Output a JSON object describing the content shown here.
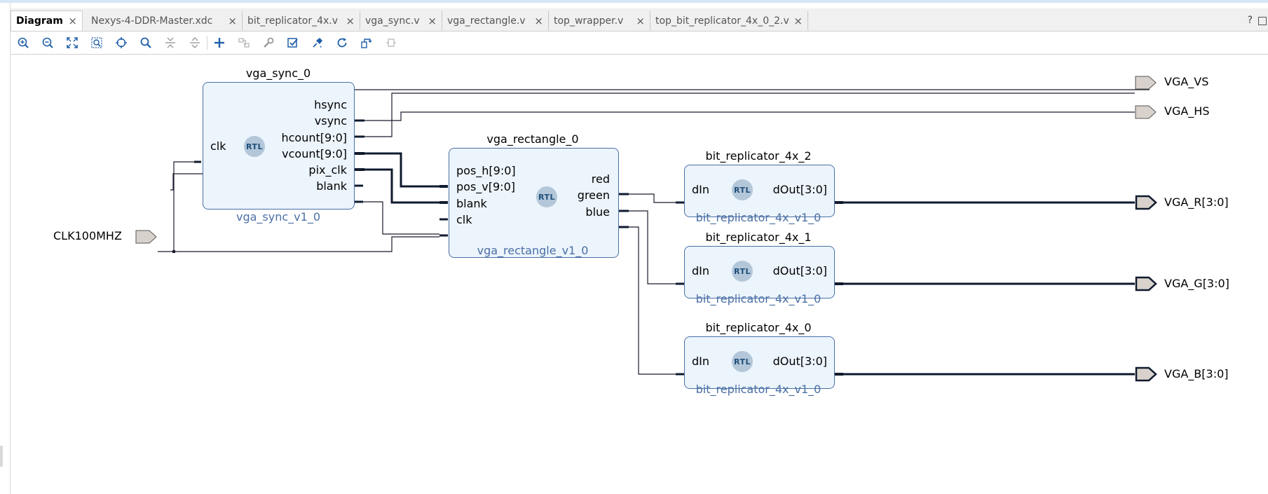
{
  "tabs": [
    {
      "label": "Diagram",
      "active": true
    },
    {
      "label": "Nexys-4-DDR-Master.xdc"
    },
    {
      "label": "bit_replicator_4x.v"
    },
    {
      "label": "vga_sync.v"
    },
    {
      "label": "vga_rectangle.v"
    },
    {
      "label": "top_wrapper.v"
    },
    {
      "label": "top_bit_replicator_4x_0_2.v"
    }
  ],
  "tab_close_glyph": "×",
  "tabbar_right": {
    "help": "?"
  },
  "toolbar": [
    "zoom-in-icon",
    "zoom-out-icon",
    "zoom-fit-icon",
    "zoom-area-icon",
    "auto-fit-selection-icon",
    "search-icon",
    "collapse-all-icon",
    "expand-all-icon",
    "add-ip-icon",
    "make-connection-icon",
    "properties-icon",
    "validate-design-icon",
    "auto-connect-icon",
    "regenerate-layout-icon",
    "optimize-routing-icon",
    "disabled-action-icon"
  ],
  "rtl_badge": "RTL",
  "blocks": {
    "vga_sync": {
      "instance": "vga_sync_0",
      "module": "vga_sync_v1_0",
      "inputs": [
        "clk"
      ],
      "outputs": [
        "hsync",
        "vsync",
        "hcount[9:0]",
        "vcount[9:0]",
        "pix_clk",
        "blank"
      ]
    },
    "vga_rectangle": {
      "instance": "vga_rectangle_0",
      "module": "vga_rectangle_v1_0",
      "inputs": [
        "pos_h[9:0]",
        "pos_v[9:0]",
        "blank",
        "clk"
      ],
      "outputs": [
        "red",
        "green",
        "blue"
      ]
    },
    "rep2": {
      "instance": "bit_replicator_4x_2",
      "module": "bit_replicator_4x_v1_0",
      "input": "dIn",
      "output": "dOut[3:0]"
    },
    "rep1": {
      "instance": "bit_replicator_4x_1",
      "module": "bit_replicator_4x_v1_0",
      "input": "dIn",
      "output": "dOut[3:0]"
    },
    "rep0": {
      "instance": "bit_replicator_4x_0",
      "module": "bit_replicator_4x_v1_0",
      "input": "dIn",
      "output": "dOut[3:0]"
    }
  },
  "ports": {
    "clk_in": "CLK100MHZ",
    "vga_vs": "VGA_VS",
    "vga_hs": "VGA_HS",
    "vga_r": "VGA_R[3:0]",
    "vga_g": "VGA_G[3:0]",
    "vga_b": "VGA_B[3:0]"
  },
  "colors": {
    "block_fill": "#ecf4fc",
    "block_border": "#4a6fa5",
    "module_text": "#4a6fa5",
    "wire": "#1a1a2e",
    "port_fill": "#d9d2cc"
  }
}
